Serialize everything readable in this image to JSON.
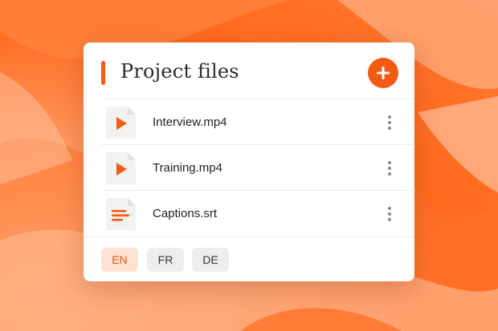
{
  "panel": {
    "title": "Project files"
  },
  "files": [
    {
      "name": "Interview.mp4",
      "icon": "video-file-icon"
    },
    {
      "name": "Training.mp4",
      "icon": "video-file-icon"
    },
    {
      "name": "Captions.srt",
      "icon": "subtitle-file-icon"
    }
  ],
  "languages": {
    "items": [
      "EN",
      "FR",
      "DE"
    ],
    "selected": "EN"
  },
  "colors": {
    "accent": "#f35b12",
    "active_lang_bg": "#ffe2d2",
    "active_lang_text": "#e45411"
  }
}
